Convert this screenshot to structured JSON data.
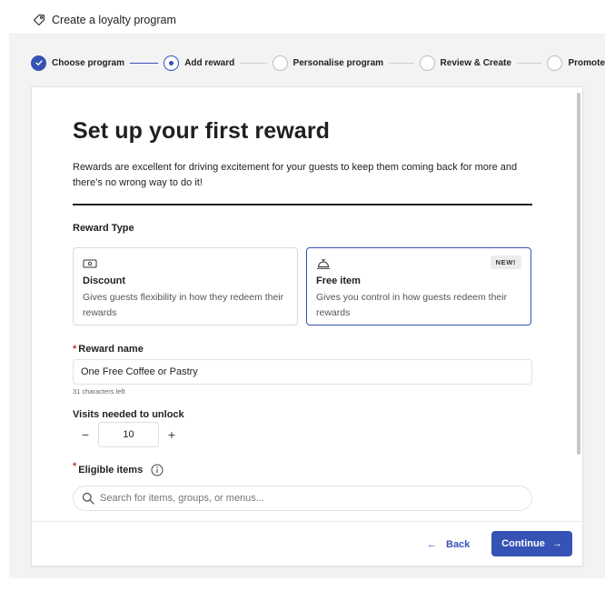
{
  "app": {
    "title": "Create a loyalty program",
    "title_icon": "tag-icon"
  },
  "stepper": {
    "steps": [
      {
        "label": "Choose program",
        "state": "done"
      },
      {
        "label": "Add reward",
        "state": "current"
      },
      {
        "label": "Personalise program",
        "state": "upcoming"
      },
      {
        "label": "Review & Create",
        "state": "upcoming"
      },
      {
        "label": "Promote",
        "state": "upcoming"
      }
    ]
  },
  "page": {
    "heading": "Set up your first reward",
    "intro": "Rewards are excellent for driving excitement for your guests to keep them coming back for more and there’s no wrong way to do it!"
  },
  "reward_type": {
    "label": "Reward Type",
    "options": [
      {
        "icon": "cash-icon",
        "title": "Discount",
        "description": "Gives guests flexibility in how they redeem their rewards",
        "selected": false,
        "badge": ""
      },
      {
        "icon": "service-bell-icon",
        "title": "Free item",
        "description": "Gives you control in how guests redeem their rewards",
        "selected": true,
        "badge": "NEW!"
      }
    ]
  },
  "reward_name": {
    "required_mark": "*",
    "label": "Reward name",
    "value": "One Free Coffee or Pastry",
    "helper": "31 characters left"
  },
  "visits": {
    "label": "Visits needed to unlock",
    "value": "10",
    "decrement": "−",
    "increment": "+"
  },
  "eligible_items": {
    "required_mark": "*",
    "label": "Eligible items",
    "placeholder": "Search for items, groups, or menus..."
  },
  "footer": {
    "back_label": "Back",
    "back_arrow": "←",
    "continue_label": "Continue",
    "continue_arrow": "→"
  },
  "colors": {
    "accent": "#3553b5",
    "required": "#c0392b"
  }
}
